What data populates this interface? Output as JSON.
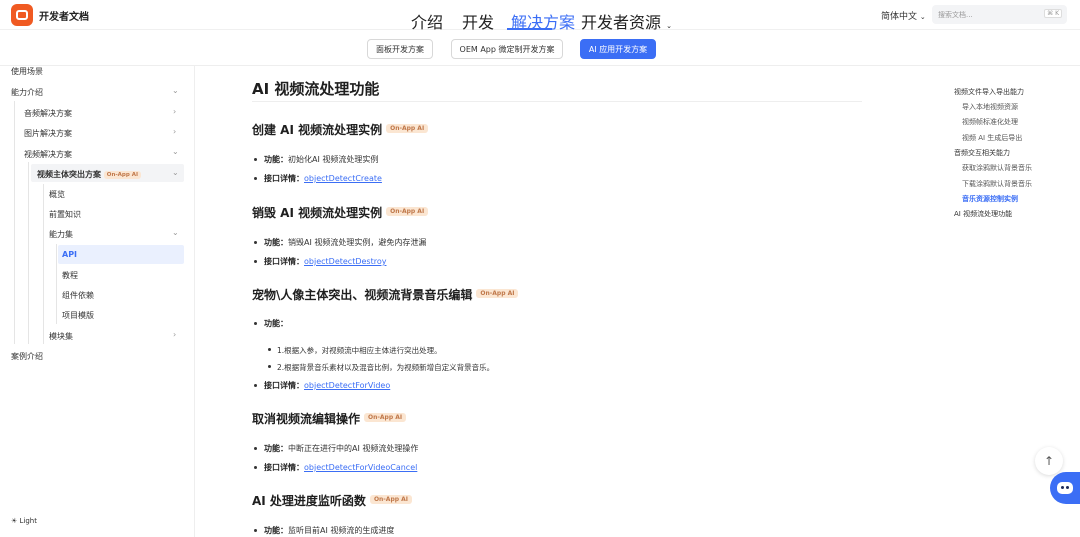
{
  "header": {
    "brand": "开发者文档",
    "nav": [
      "介绍",
      "开发",
      "解决方案",
      "开发者资源"
    ],
    "lang": "简体中文",
    "search_placeholder": "搜索文档...",
    "search_shortcut": "⌘ K"
  },
  "solutions": [
    "面板开发方案",
    "OEM App 微定制开发方案",
    "AI 应用开发方案"
  ],
  "sidebar": {
    "items": [
      "使用场景",
      "能力介绍",
      "音频解决方案",
      "图片解决方案",
      "视频解决方案",
      "视频主体突出方案",
      "概览",
      "前置知识",
      "能力集",
      "API",
      "教程",
      "组件依赖",
      "项目模版",
      "模块集",
      "案例介绍"
    ],
    "tag": "On-App AI",
    "theme": "Light"
  },
  "main": {
    "title": "AI 视频流处理功能",
    "tag": "On-App AI",
    "sections": [
      {
        "heading": "创建 AI 视频流处理实例",
        "func_label": "功能：",
        "func_text": "初始化AI 视频流处理实例",
        "api_label": "接口详情：",
        "api_link": "objectDetectCreate"
      },
      {
        "heading": "销毁 AI 视频流处理实例",
        "func_label": "功能：",
        "func_text": "销毁AI 视频流处理实例，避免内存泄漏",
        "api_label": "接口详情：",
        "api_link": "objectDetectDestroy"
      },
      {
        "heading": "宠物\\人像主体突出、视频流背景音乐编辑",
        "func_label": "功能：",
        "sub": [
          "1.根据入参，对视频流中相应主体进行突出处理。",
          "2.根据背景音乐素材以及混音比例，为视频新增自定义背景音乐。"
        ],
        "api_label": "接口详情：",
        "api_link": "objectDetectForVideo"
      },
      {
        "heading": "取消视频流编辑操作",
        "func_label": "功能：",
        "func_text": "中断正在进行中的AI 视频流处理操作",
        "api_label": "接口详情：",
        "api_link": "objectDetectForVideoCancel"
      },
      {
        "heading": "AI 处理进度监听函数",
        "func_label": "功能：",
        "func_text": "监听目前AI 视频流的生成进度"
      }
    ]
  },
  "toc": [
    "视频文件导入导出能力",
    "导入本地视频资源",
    "视频帧标准化处理",
    "视频 AI 生成后导出",
    "音频交互相关能力",
    "获取涂鸦默认背景音乐",
    "下载涂鸦默认背景音乐",
    "音乐资源控制实例",
    "AI 视频流处理功能"
  ],
  "colors": {
    "accent": "#3b6ef5",
    "tag_bg": "#fbe6d2",
    "tag_text": "#c0784a",
    "logo": "#f05a22"
  }
}
